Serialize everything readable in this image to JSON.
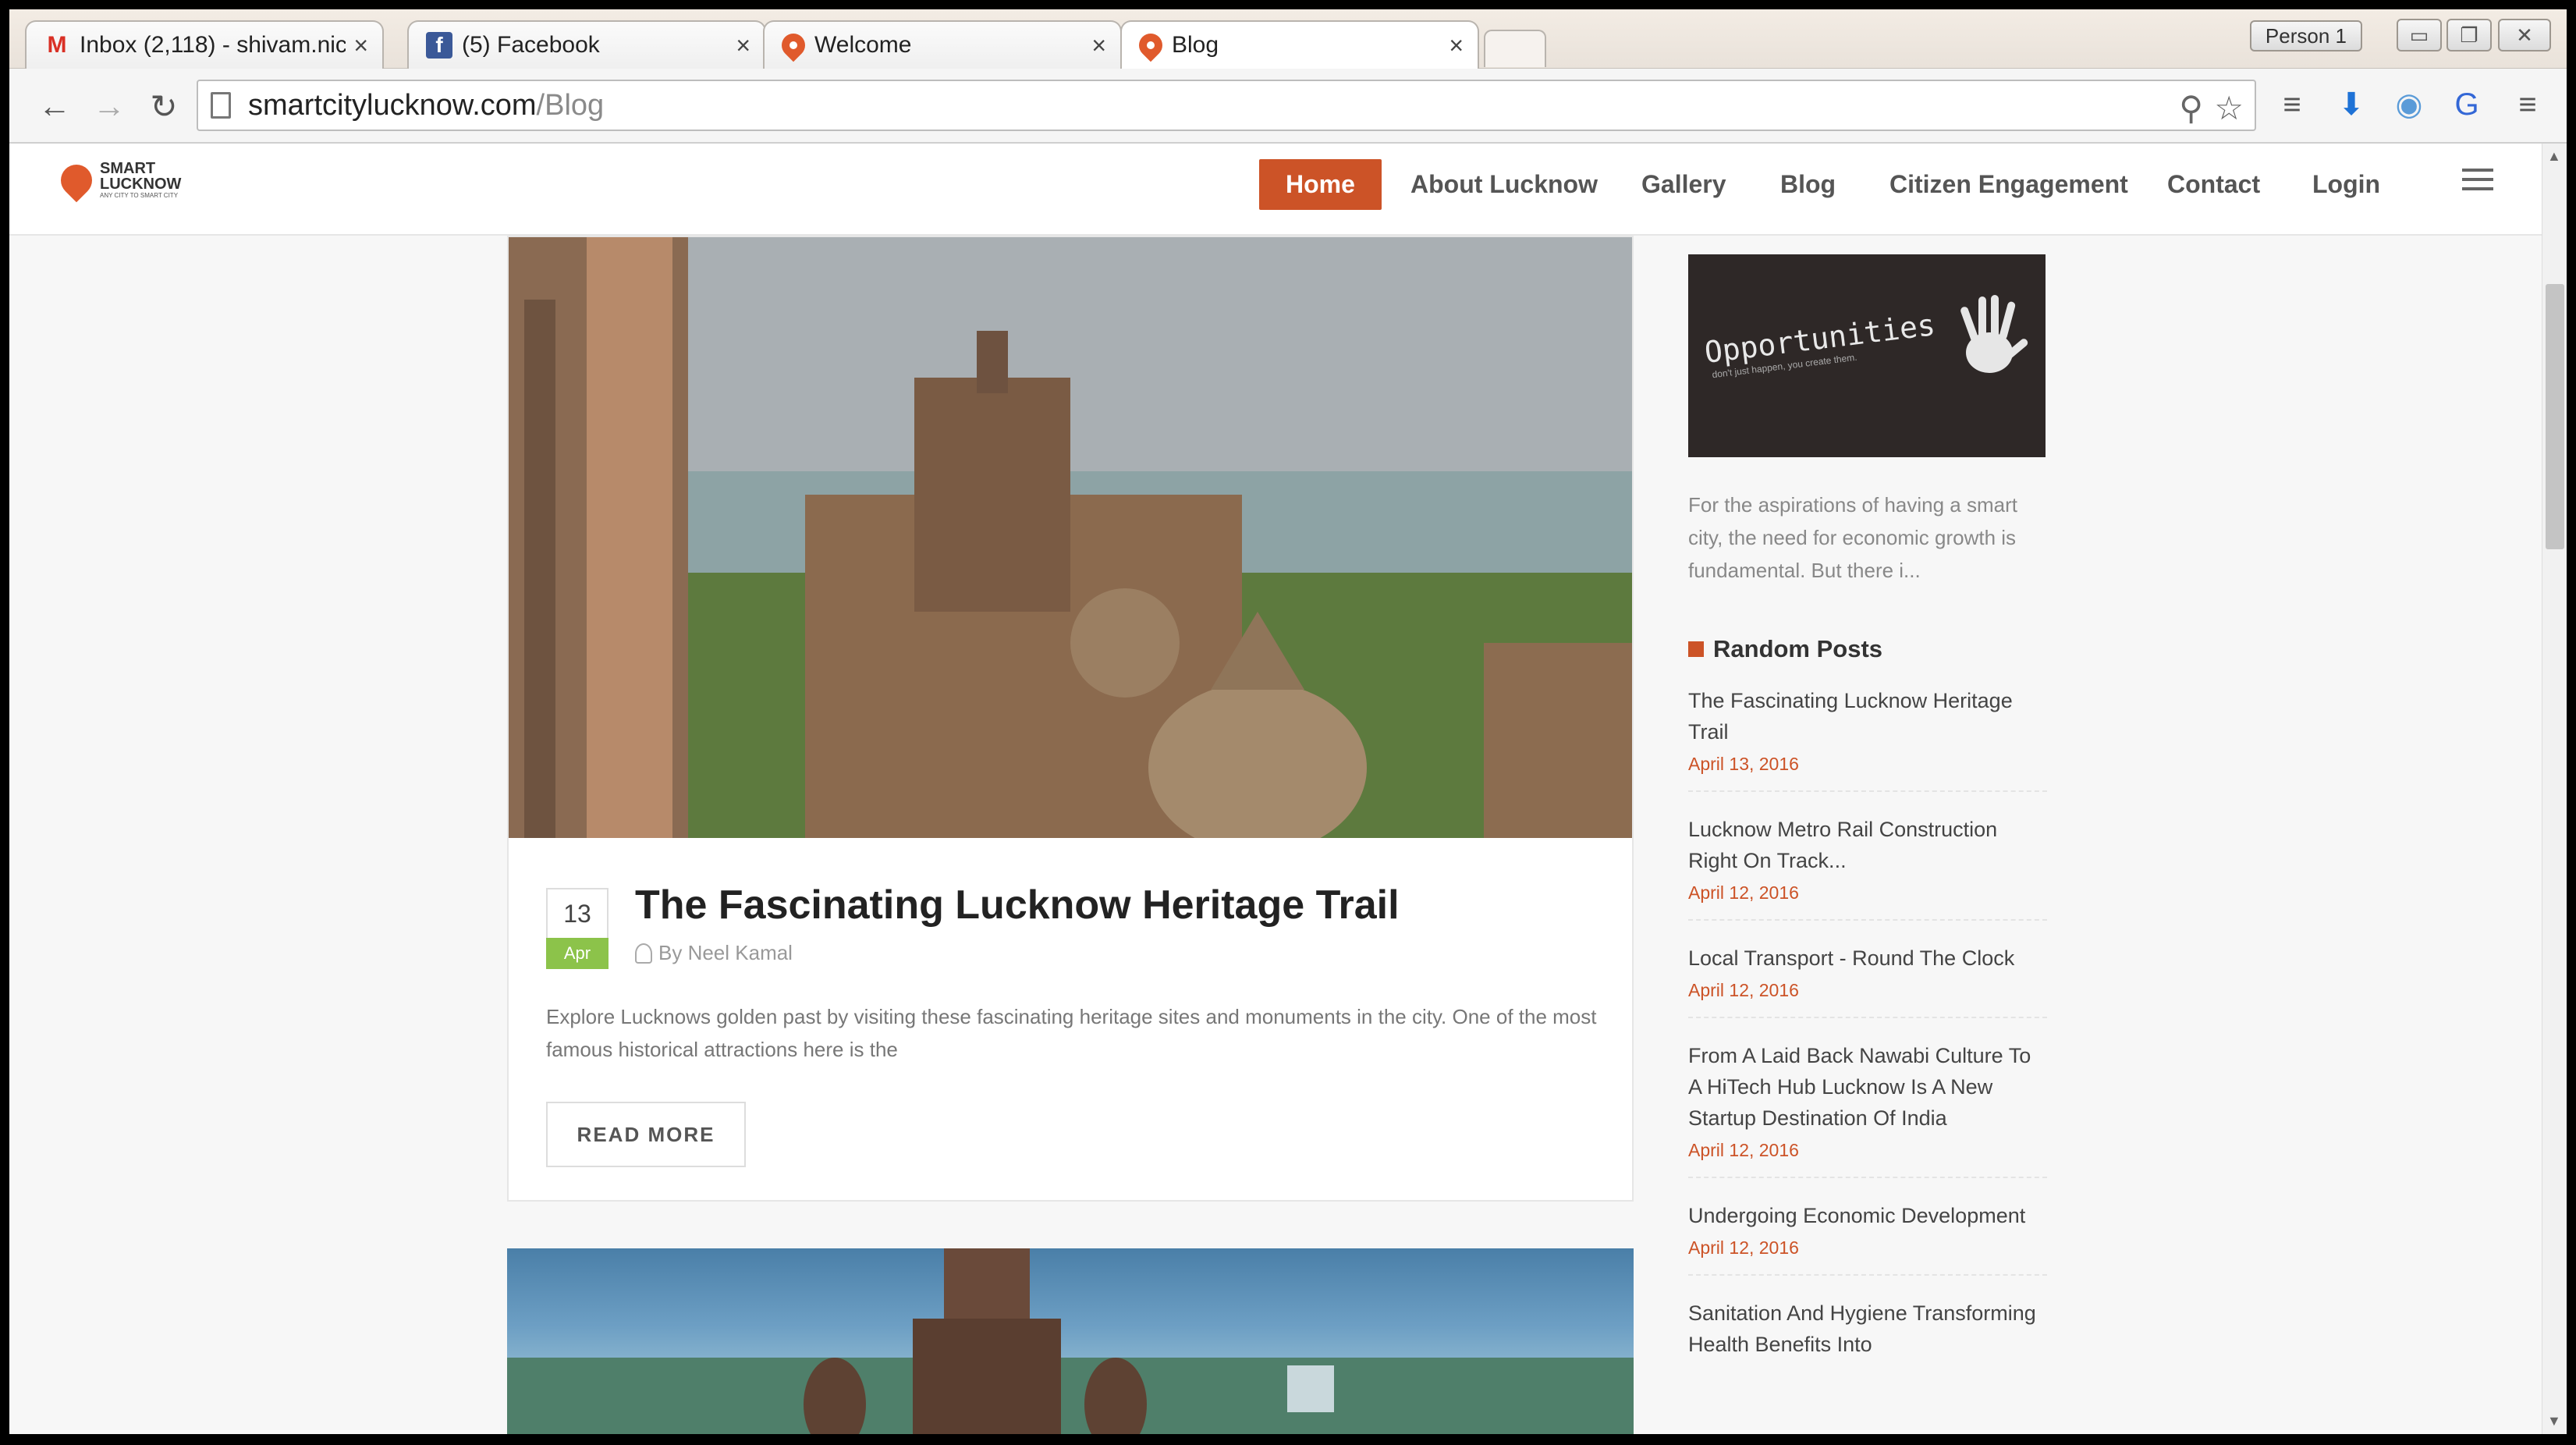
{
  "browser": {
    "tabs": [
      {
        "title": "Inbox (2,118) - shivam.nic",
        "favicon": "gmail-icon"
      },
      {
        "title": "(5) Facebook",
        "favicon": "facebook-icon"
      },
      {
        "title": "Welcome",
        "favicon": "smart-lucknow-icon"
      },
      {
        "title": "Blog",
        "favicon": "smart-lucknow-icon"
      }
    ],
    "active_tab": 3,
    "close_glyph": "×",
    "profile_button": "Person 1",
    "url_host": "smartcitylucknow.com",
    "url_path": "/Blog"
  },
  "site": {
    "logo": {
      "line1": "SMART",
      "line2": "LUCKNOW",
      "tagline": "ANY CITY TO SMART CITY"
    },
    "nav": [
      "Home",
      "About Lucknow",
      "Gallery",
      "Blog",
      "Citizen Engagement",
      "Contact",
      "Login"
    ],
    "active_nav": "Home",
    "accent": "#cc5327"
  },
  "post": {
    "day": "13",
    "month": "Apr",
    "title": "The Fascinating Lucknow Heritage Trail",
    "author": "By Neel Kamal",
    "excerpt": "Explore Lucknows golden past by visiting these fascinating heritage sites and monuments in the city. One of the most famous historical attractions here is the",
    "read_more": "READ MORE"
  },
  "sidebar": {
    "ad_title": "Opportunities",
    "ad_subtitle": "don't just happen, you create them.",
    "ad_text": "For the aspirations of having a smart city, the need for economic growth is fundamental. But there i...",
    "random_heading": "Random Posts",
    "random_posts": [
      {
        "title": "The Fascinating Lucknow Heritage Trail",
        "date": "April 13, 2016"
      },
      {
        "title": "Lucknow Metro Rail Construction Right On Track...",
        "date": "April 12, 2016"
      },
      {
        "title": "Local Transport - Round The Clock",
        "date": "April 12, 2016"
      },
      {
        "title": "From A Laid Back Nawabi Culture To A HiTech Hub Lucknow Is A New Startup Destination Of India",
        "date": "April 12, 2016"
      },
      {
        "title": "Undergoing Economic Development",
        "date": "April 12, 2016"
      },
      {
        "title": "Sanitation And Hygiene Transforming Health Benefits Into",
        "date": ""
      }
    ]
  }
}
